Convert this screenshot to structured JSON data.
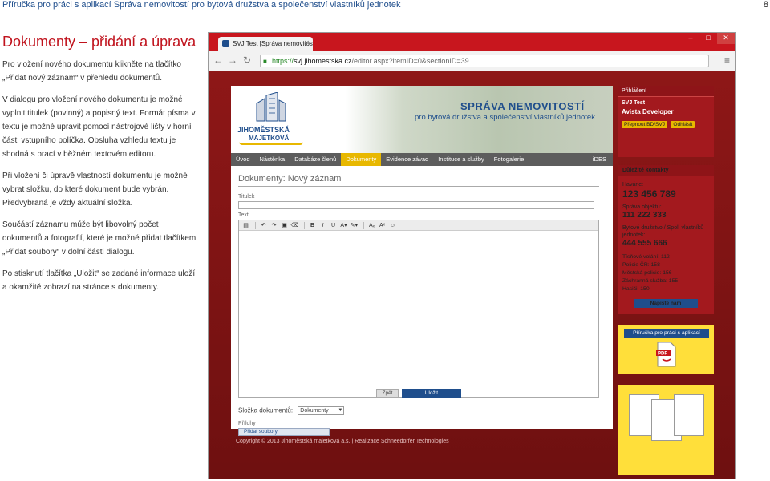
{
  "header": {
    "title": "Příručka pro práci s aplikací Správa nemovitostí pro bytová družstva a společenství vlastníků jednotek",
    "page_number": "8"
  },
  "doc": {
    "title": "Dokumenty – přidání a úprava",
    "paragraphs": [
      "Pro vložení nového dokumentu klikněte na tlačítko „Přidat nový záznam“ v přehledu dokumentů.",
      "V dialogu pro vložení nového dokumentu je možné vyplnit titulek (povinný) a popisný text. Formát písma v textu je možné upravit pomocí nástrojové lišty v horní části vstupního políčka. Obsluha vzhledu textu je shodná s prací v běžném textovém editoru.",
      "Při vložení či úpravě vlastností dokumentu je možné vybrat složku, do které dokument bude vybrán. Předvybraná je vždy aktuální složka.",
      "Součástí záznamu může být libovolný počet dokumentů a fotografií, které je možné přidat tlačítkem „Přidat soubory“ v dolní části dialogu.",
      "Po stisknutí tlačítka „Uložit“ se zadané informace uloží a okamžitě zobrazí na stránce s dokumenty."
    ]
  },
  "browser": {
    "tab_title": "SVJ Test [Správa nemovitostí",
    "url_https": "https://",
    "url_host": "svj.jihomestska.cz",
    "url_path": "/editor.aspx?itemID=0&sectionID=39"
  },
  "site": {
    "logo_line1": "JIHOMĚSTSKÁ",
    "logo_line2": "MAJETKOVÁ",
    "heading": "SPRÁVA NEMOVITOSTÍ",
    "subheading": "pro bytová družstva a společenství vlastníků jednotek",
    "nav": [
      "Úvod",
      "Nástěnka",
      "Databáze členů",
      "Dokumenty",
      "Evidence závad",
      "Instituce a služby",
      "Fotogalerie"
    ],
    "nav_right": "iDES",
    "form_title": "Dokumenty: Nový záznam",
    "label_title": "Titulek",
    "label_text": "Text",
    "folder_label": "Složka dokumentů:",
    "folder_value": "Dokumenty",
    "attachments_label": "Přílohy",
    "add_files": "Přidat soubory",
    "btn_back": "Zpět",
    "btn_save": "Uložit",
    "footer": "Copyright © 2013 Jihoměstská majetková a.s.  |  Realizace Schneedorfer Technologies"
  },
  "sidebar": {
    "login_heading": "Přihlášení",
    "svj": "SVJ Test",
    "user": "Avista Developer",
    "btn_switch": "Přepnout BD/SVJ",
    "btn_logout": "Odhlásit",
    "contacts_heading": "Důležité kontakty",
    "havarie_label": "Havárie:",
    "havarie_num": "123 456 789",
    "sprava_label": "Správa objektu:",
    "sprava_num": "111 222 333",
    "bd_label": "Bytové družstvo / Spol. vlastníků jednotek:",
    "bd_num": "444 555 666",
    "emergency": [
      "Tísňové volání: 112",
      "Policie ČR: 158",
      "Městská policie: 156",
      "Záchranná služba: 155",
      "Hasiči: 150"
    ],
    "write_btn": "Napište nám",
    "pdf_title": "Příručka pro práci s aplikací"
  }
}
